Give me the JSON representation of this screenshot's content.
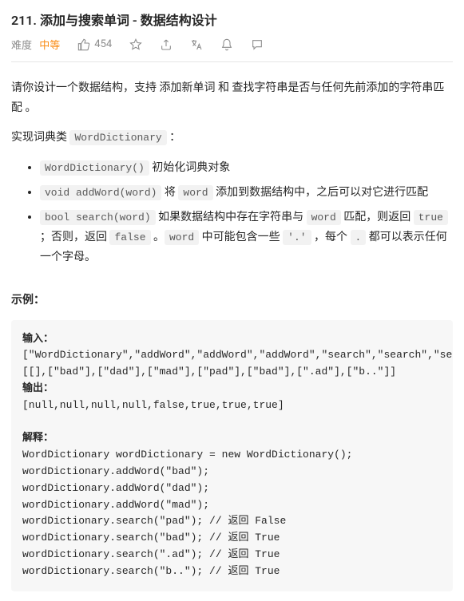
{
  "title": "211. 添加与搜索单词 - 数据结构设计",
  "meta": {
    "difficulty_label": "难度",
    "difficulty_value": "中等",
    "likes": "454"
  },
  "description": {
    "p1": "请你设计一个数据结构，支持 添加新单词 和 查找字符串是否与任何先前添加的字符串匹配 。",
    "p2_prefix": "实现词典类 ",
    "p2_code": "WordDictionary",
    "p2_suffix": " ：",
    "methods": [
      {
        "code": "WordDictionary()",
        "after": " 初始化词典对象"
      },
      {
        "code": "void addWord(word)",
        "mid1": " 将 ",
        "code2": "word",
        "after": " 添加到数据结构中，之后可以对它进行匹配"
      },
      {
        "code": "bool search(word)",
        "mid1": " 如果数据结构中存在字符串与 ",
        "code2": "word",
        "mid2": " 匹配，则返回 ",
        "code3": "true",
        "mid3": " ；否则，返回 ",
        "code4": "false",
        "mid4": " 。",
        "code5": "word",
        "mid5": " 中可能包含一些 ",
        "code6": "'.'",
        "mid6": " ，每个 ",
        "code7": ".",
        "after": " 都可以表示任何一个字母。"
      }
    ],
    "example_label": "示例：",
    "example": {
      "input_label": "输入：",
      "input_line1": "[\"WordDictionary\",\"addWord\",\"addWord\",\"addWord\",\"search\",\"search\",\"search\",\"search\"]",
      "input_line2": "[[],[\"bad\"],[\"dad\"],[\"mad\"],[\"pad\"],[\"bad\"],[\".ad\"],[\"b..\"]]",
      "output_label": "输出：",
      "output_line": "[null,null,null,null,false,true,true,true]",
      "explain_label": "解释：",
      "explain_lines": [
        "WordDictionary wordDictionary = new WordDictionary();",
        "wordDictionary.addWord(\"bad\");",
        "wordDictionary.addWord(\"dad\");",
        "wordDictionary.addWord(\"mad\");",
        "wordDictionary.search(\"pad\"); // 返回 False",
        "wordDictionary.search(\"bad\"); // 返回 True",
        "wordDictionary.search(\".ad\"); // 返回 True",
        "wordDictionary.search(\"b..\"); // 返回 True"
      ]
    }
  }
}
